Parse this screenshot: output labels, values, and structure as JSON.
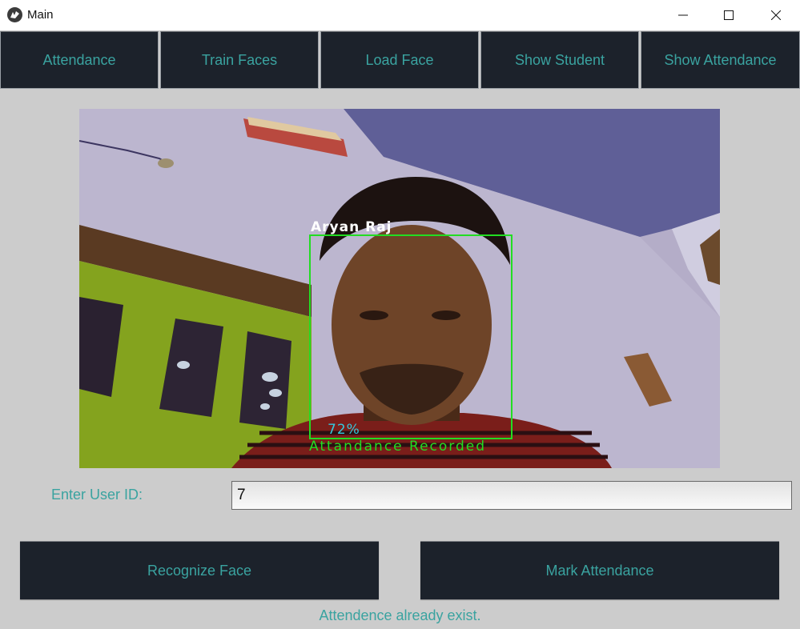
{
  "window": {
    "title": "Main",
    "app_icon": "kivy-logo-icon",
    "controls": {
      "minimize": "minimize-icon",
      "maximize": "maximize-icon",
      "close": "close-icon"
    }
  },
  "nav": {
    "buttons": [
      {
        "label": "Attendance"
      },
      {
        "label": "Train Faces"
      },
      {
        "label": "Load Face"
      },
      {
        "label": "Show Student"
      },
      {
        "label": "Show Attendance"
      }
    ]
  },
  "camera": {
    "detected_name": "Aryan  Raj",
    "confidence": "72%",
    "overlay_status": "Attandance  Recorded",
    "box_color": "#22dd22",
    "confidence_color": "#35c8dd"
  },
  "form": {
    "user_id_label": "Enter User ID:",
    "user_id_value": "7"
  },
  "actions": {
    "recognize_label": "Recognize Face",
    "mark_label": "Mark Attendance"
  },
  "status": {
    "message": "Attendence already exist."
  },
  "theme": {
    "button_bg": "#1c222b",
    "accent_text": "#3aa3a0",
    "window_bg": "#cccccc"
  }
}
